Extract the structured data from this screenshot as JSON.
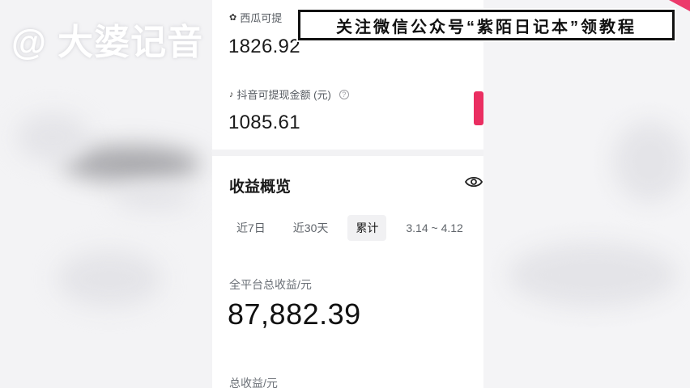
{
  "watermark": "@ 大婆记音",
  "banner": {
    "text": "关注微信公众号“紫陌日记本”领教程"
  },
  "earnings": {
    "xigua": {
      "label": "西瓜可提",
      "value": "1826.92"
    },
    "douyin": {
      "label": "抖音可提现金额 (元)",
      "value": "1085.61"
    }
  },
  "overview": {
    "title": "收益概览",
    "tabs": [
      {
        "label": "近7日",
        "active": false
      },
      {
        "label": "近30天",
        "active": false
      },
      {
        "label": "累计",
        "active": true
      },
      {
        "label": "3.14 ~ 4.12",
        "active": false
      }
    ],
    "total_label": "全平台总收益/元",
    "total_value": "87,882.39",
    "sub_label": "总收益/元"
  },
  "colors": {
    "accent_pink": "#ea2e61",
    "banner_border": "#111111"
  }
}
